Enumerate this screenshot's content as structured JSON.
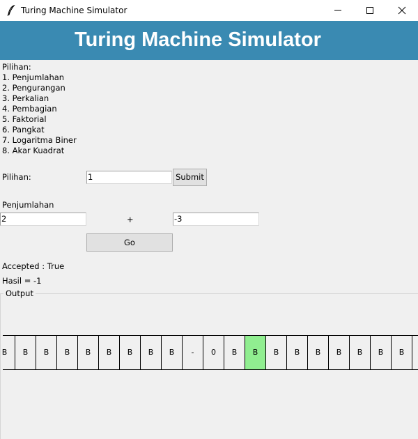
{
  "window": {
    "title": "Turing Machine Simulator",
    "icon": "feather-icon",
    "controls": [
      "minimize-icon",
      "maximize-icon",
      "close-icon"
    ]
  },
  "banner": {
    "title": "Turing Machine Simulator",
    "background": "#3a8ab2"
  },
  "menu": {
    "heading": "Pilihan:",
    "items": [
      "1. Penjumlahan",
      "2. Pengurangan",
      "3. Perkalian",
      "4. Pembagian",
      "5. Faktorial",
      "6. Pangkat",
      "7. Logaritma Biner",
      "8. Akar Kuadrat"
    ]
  },
  "choice": {
    "label": "Pilihan:",
    "value": "1",
    "submit_label": "Submit"
  },
  "operation": {
    "name": "Penjumlahan",
    "operand1": "2",
    "operator": "+",
    "operand2": "-3",
    "go_label": "Go"
  },
  "result": {
    "accepted": "Accepted : True",
    "hasil": "Hasil = -1"
  },
  "output": {
    "legend": "Output",
    "head_color": "#90ee90",
    "tape": [
      "B",
      "B",
      "B",
      "B",
      "B",
      "B",
      "B",
      "B",
      "B",
      "-",
      "0",
      "B",
      "B",
      "B",
      "B",
      "B",
      "B",
      "B",
      "B",
      "B"
    ],
    "head_index": 12
  }
}
